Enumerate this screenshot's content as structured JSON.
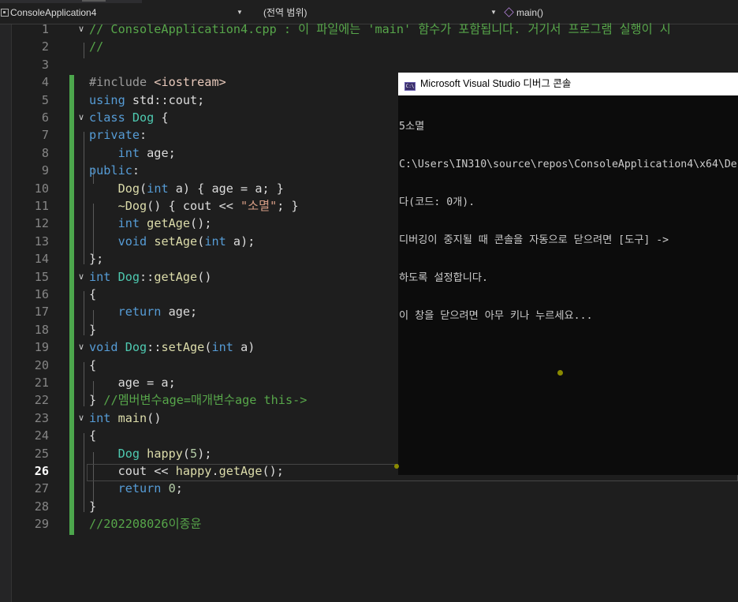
{
  "navbar": {
    "project_dropdown": "ConsoleApplication4",
    "scope_dropdown": "(전역 범위)",
    "member_dropdown": "main()"
  },
  "editor": {
    "active_line": 26,
    "lines": [
      {
        "n": "1",
        "fold": "∨",
        "segs": [
          [
            "cm",
            "// ConsoleApplication4.cpp : 이 파일에는 'main' 함수가 포함됩니다. 거기서 프로그램 실행이 시"
          ]
        ]
      },
      {
        "n": "2",
        "fold": "",
        "segs": [
          [
            "cm",
            "//"
          ]
        ]
      },
      {
        "n": "3",
        "fold": "",
        "segs": []
      },
      {
        "n": "4",
        "fold": "",
        "segs": [
          [
            "pp",
            "#include "
          ],
          [
            "inc",
            "<iostream>"
          ]
        ]
      },
      {
        "n": "5",
        "fold": "",
        "segs": [
          [
            "kw",
            "using "
          ],
          [
            "pl",
            "std::cout;"
          ]
        ]
      },
      {
        "n": "6",
        "fold": "∨",
        "segs": [
          [
            "kw",
            "class "
          ],
          [
            "ty",
            "Dog"
          ],
          [
            "pl",
            " {"
          ]
        ]
      },
      {
        "n": "7",
        "fold": "",
        "segs": [
          [
            "kw",
            "private"
          ],
          [
            "pl",
            ":"
          ]
        ]
      },
      {
        "n": "8",
        "fold": "",
        "segs": [
          [
            "pl",
            "    "
          ],
          [
            "kw",
            "int"
          ],
          [
            "pl",
            " age;"
          ]
        ]
      },
      {
        "n": "9",
        "fold": "",
        "segs": [
          [
            "kw",
            "public"
          ],
          [
            "pl",
            ":"
          ]
        ]
      },
      {
        "n": "10",
        "fold": "",
        "segs": [
          [
            "pl",
            "    "
          ],
          [
            "fn",
            "Dog"
          ],
          [
            "pl",
            "("
          ],
          [
            "kw",
            "int"
          ],
          [
            "pl",
            " a) { age = a; }"
          ]
        ]
      },
      {
        "n": "11",
        "fold": "",
        "segs": [
          [
            "pl",
            "    "
          ],
          [
            "fn",
            "~Dog"
          ],
          [
            "pl",
            "() { cout << "
          ],
          [
            "st",
            "\"소멸\""
          ],
          [
            "pl",
            "; }"
          ]
        ]
      },
      {
        "n": "12",
        "fold": "",
        "segs": [
          [
            "pl",
            "    "
          ],
          [
            "kw",
            "int"
          ],
          [
            "pl",
            " "
          ],
          [
            "fn",
            "getAge"
          ],
          [
            "pl",
            "();"
          ]
        ]
      },
      {
        "n": "13",
        "fold": "",
        "segs": [
          [
            "pl",
            "    "
          ],
          [
            "kw",
            "void"
          ],
          [
            "pl",
            " "
          ],
          [
            "fn",
            "setAge"
          ],
          [
            "pl",
            "("
          ],
          [
            "kw",
            "int"
          ],
          [
            "pl",
            " a);"
          ]
        ]
      },
      {
        "n": "14",
        "fold": "",
        "segs": [
          [
            "pl",
            "};"
          ]
        ]
      },
      {
        "n": "15",
        "fold": "∨",
        "segs": [
          [
            "kw",
            "int"
          ],
          [
            "pl",
            " "
          ],
          [
            "ty",
            "Dog"
          ],
          [
            "pl",
            "::"
          ],
          [
            "fn",
            "getAge"
          ],
          [
            "pl",
            "()"
          ]
        ]
      },
      {
        "n": "16",
        "fold": "",
        "segs": [
          [
            "pl",
            "{"
          ]
        ]
      },
      {
        "n": "17",
        "fold": "",
        "segs": [
          [
            "pl",
            "    "
          ],
          [
            "kw",
            "return"
          ],
          [
            "pl",
            " age;"
          ]
        ]
      },
      {
        "n": "18",
        "fold": "",
        "segs": [
          [
            "pl",
            "}"
          ]
        ]
      },
      {
        "n": "19",
        "fold": "∨",
        "segs": [
          [
            "kw",
            "void"
          ],
          [
            "pl",
            " "
          ],
          [
            "ty",
            "Dog"
          ],
          [
            "pl",
            "::"
          ],
          [
            "fn",
            "setAge"
          ],
          [
            "pl",
            "("
          ],
          [
            "kw",
            "int"
          ],
          [
            "pl",
            " a)"
          ]
        ]
      },
      {
        "n": "20",
        "fold": "",
        "segs": [
          [
            "pl",
            "{"
          ]
        ]
      },
      {
        "n": "21",
        "fold": "",
        "segs": [
          [
            "pl",
            "    age = a;"
          ]
        ]
      },
      {
        "n": "22",
        "fold": "",
        "segs": [
          [
            "pl",
            "} "
          ],
          [
            "cm",
            "//멤버변수age=매개변수age this->"
          ]
        ]
      },
      {
        "n": "23",
        "fold": "∨",
        "segs": [
          [
            "kw",
            "int"
          ],
          [
            "pl",
            " "
          ],
          [
            "fn",
            "main"
          ],
          [
            "pl",
            "()"
          ]
        ]
      },
      {
        "n": "24",
        "fold": "",
        "segs": [
          [
            "pl",
            "{"
          ]
        ]
      },
      {
        "n": "25",
        "fold": "",
        "segs": [
          [
            "pl",
            "    "
          ],
          [
            "ty",
            "Dog"
          ],
          [
            "pl",
            " "
          ],
          [
            "fn",
            "happy"
          ],
          [
            "pl",
            "("
          ],
          [
            "nm",
            "5"
          ],
          [
            "pl",
            ");"
          ]
        ]
      },
      {
        "n": "26",
        "fold": "",
        "segs": [
          [
            "pl",
            "    cout << "
          ],
          [
            "fn",
            "happy"
          ],
          [
            "pl",
            "."
          ],
          [
            "fn",
            "getAge"
          ],
          [
            "pl",
            "();"
          ]
        ]
      },
      {
        "n": "27",
        "fold": "",
        "segs": [
          [
            "pl",
            "    "
          ],
          [
            "kw",
            "return"
          ],
          [
            "pl",
            " "
          ],
          [
            "nm",
            "0"
          ],
          [
            "pl",
            ";"
          ]
        ]
      },
      {
        "n": "28",
        "fold": "",
        "segs": [
          [
            "pl",
            "}"
          ]
        ]
      },
      {
        "n": "29",
        "fold": "",
        "segs": [
          [
            "cm",
            "//202208026이종윤"
          ]
        ]
      }
    ]
  },
  "console": {
    "title": "Microsoft Visual Studio 디버그 콘솔",
    "icon_text": "C:\\",
    "lines": [
      "5소멸",
      "C:\\Users\\IN310\\source\\repos\\ConsoleApplication4\\x64\\De",
      "다(코드: 0개).",
      "디버깅이 중지될 때 콘솔을 자동으로 닫으려면 [도구] ->",
      "하도록 설정합니다.",
      "이 창을 닫으려면 아무 키나 누르세요..."
    ]
  },
  "colors": {
    "background": "#1e1e1e",
    "comment": "#57a64a",
    "keyword": "#569cd6",
    "type": "#4ec9b0",
    "function": "#dcdcaa",
    "string": "#d69d85",
    "number": "#b5cea8",
    "change_bar": "#4ca64c"
  }
}
